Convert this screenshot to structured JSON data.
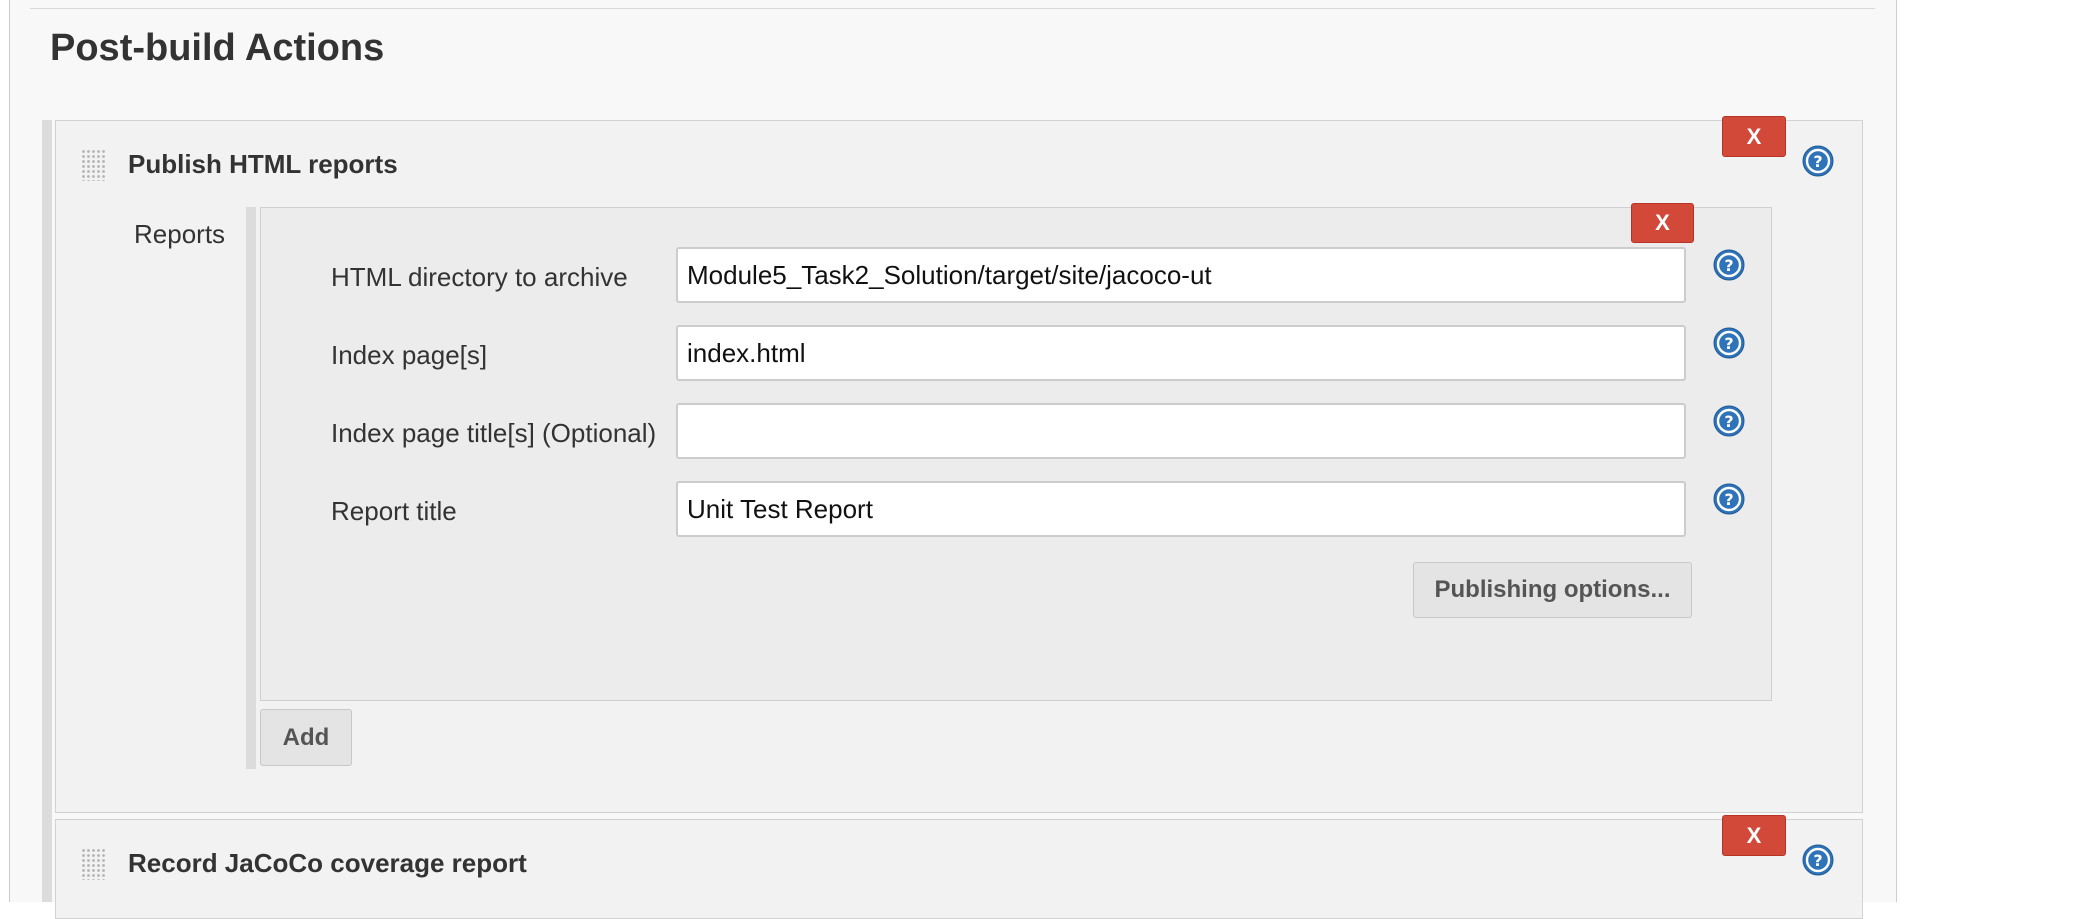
{
  "section": {
    "title": "Post-build Actions"
  },
  "publish_html": {
    "title": "Publish HTML reports",
    "delete_label": "X",
    "reports_label": "Reports",
    "entry": {
      "delete_label": "X",
      "fields": [
        {
          "label": "HTML directory to archive",
          "value": "Module5_Task2_Solution/target/site/jacoco-ut",
          "placeholder": ""
        },
        {
          "label": "Index page[s]",
          "value": "index.html",
          "placeholder": ""
        },
        {
          "label": "Index page title[s] (Optional)",
          "value": "",
          "placeholder": ""
        },
        {
          "label": "Report title",
          "value": "Unit Test Report",
          "placeholder": ""
        }
      ],
      "publishing_options_label": "Publishing options..."
    },
    "add_label": "Add"
  },
  "jacoco": {
    "title": "Record JaCoCo coverage report",
    "delete_label": "X"
  },
  "icons": {
    "drag": "drag-handle-icon",
    "help": "help-icon",
    "delete": "delete-icon"
  },
  "colors": {
    "delete_red": "#d24939",
    "help_blue": "#2f73b8",
    "panel_bg": "#f2f2f2"
  }
}
